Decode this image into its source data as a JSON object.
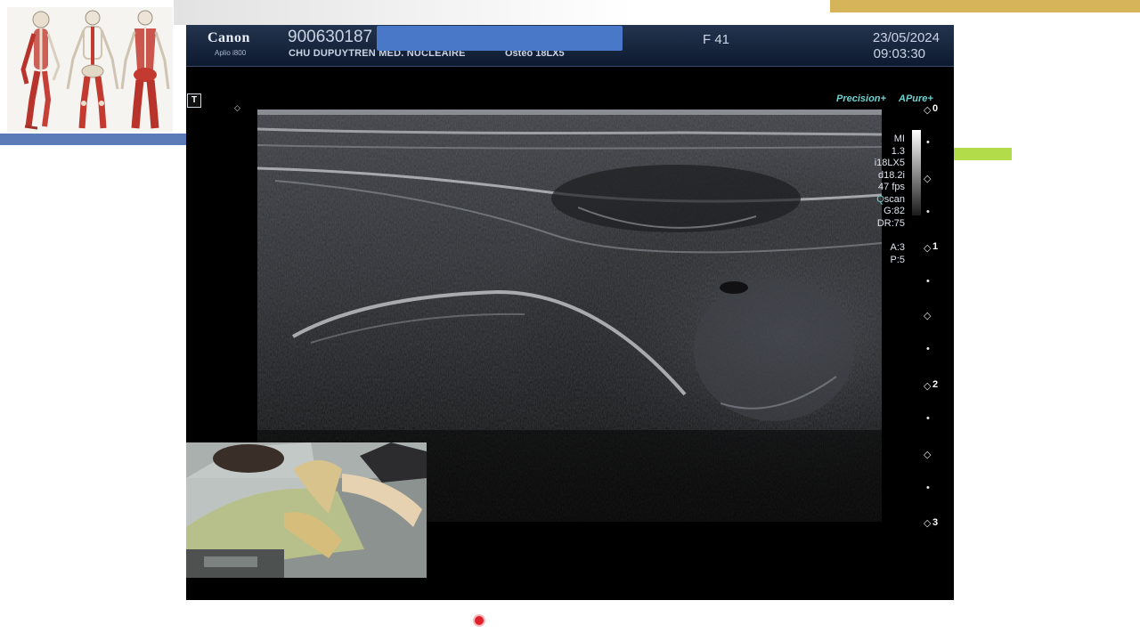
{
  "header": {
    "brand": "Canon",
    "model": "Aplio i800",
    "patient_id": "900630187",
    "institution": "CHU DUPUYTREN MED. NUCLEAIRE",
    "preset": "Osteo 18LX5",
    "frequency_label": "F 41",
    "date": "23/05/2024",
    "time": "09:03:30"
  },
  "overlay": {
    "t_icon": "T",
    "precision": "Precision+",
    "apure": "Pure+"
  },
  "params": {
    "mi_label": "MI",
    "mi_value": "1.3",
    "probe": "i18LX5",
    "depth": "d18.2i",
    "fps": "47 fps",
    "qscan": "scan",
    "gain": "G:82",
    "dynamic_range": "DR:75",
    "a": "A:3",
    "p": "P:5"
  },
  "depth_scale": {
    "labels": [
      "0",
      "1",
      "2",
      "3"
    ]
  },
  "icons": {
    "t_icon": "text-annotation-icon",
    "marker": "diamond-marker-icon"
  },
  "colors": {
    "redaction": "#4a78c8",
    "accent_gold": "#d6b45a",
    "accent_green": "#b3dc4a",
    "accent_blue": "#5a7ab8",
    "overlay_cyan": "#6fd0d0"
  }
}
